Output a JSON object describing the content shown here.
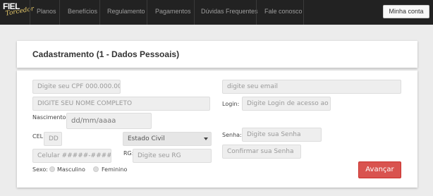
{
  "logo": {
    "main": "FIEL",
    "sub": "Torcedor"
  },
  "nav": {
    "items": [
      {
        "label": "Planos"
      },
      {
        "label": "Benefícios"
      },
      {
        "label": "Regulamento"
      },
      {
        "label": "Pagamentos"
      },
      {
        "label": "Dúvidas Frequentes"
      },
      {
        "label": "Fale conosco"
      }
    ],
    "account_button": "Minha conta"
  },
  "header": {
    "title": "Cadastramento (1 - Dados Pessoais)"
  },
  "form": {
    "cpf": {
      "placeholder": "Digite seu CPF 000.000.00"
    },
    "nome": {
      "placeholder": "DIGITE SEU NOME COMPLETO"
    },
    "nascimento": {
      "label": "Nascimento:",
      "placeholder": "dd/mm/aaaa"
    },
    "cel": {
      "label": "CEL:",
      "ddd_placeholder": "DD",
      "phone_placeholder": "Celular #####-####"
    },
    "estado_civil": {
      "selected": "Estado Civil"
    },
    "rg": {
      "label": "RG:",
      "placeholder": "Digite seu RG"
    },
    "sexo": {
      "label": "Sexo:",
      "options": [
        "Masculino",
        "Feminino"
      ]
    },
    "email": {
      "placeholder": "digite seu email"
    },
    "login": {
      "label": "Login:",
      "placeholder": "Digite Login de acesso ao"
    },
    "senha": {
      "label": "Senha:",
      "placeholder": "Digite sua Senha"
    },
    "confirmar": {
      "placeholder": "Confirmar sua Senha"
    },
    "submit_label": "Avançar"
  },
  "colors": {
    "navbar": "#222222",
    "accent_button": "#d9534f",
    "background": "#ececec"
  }
}
